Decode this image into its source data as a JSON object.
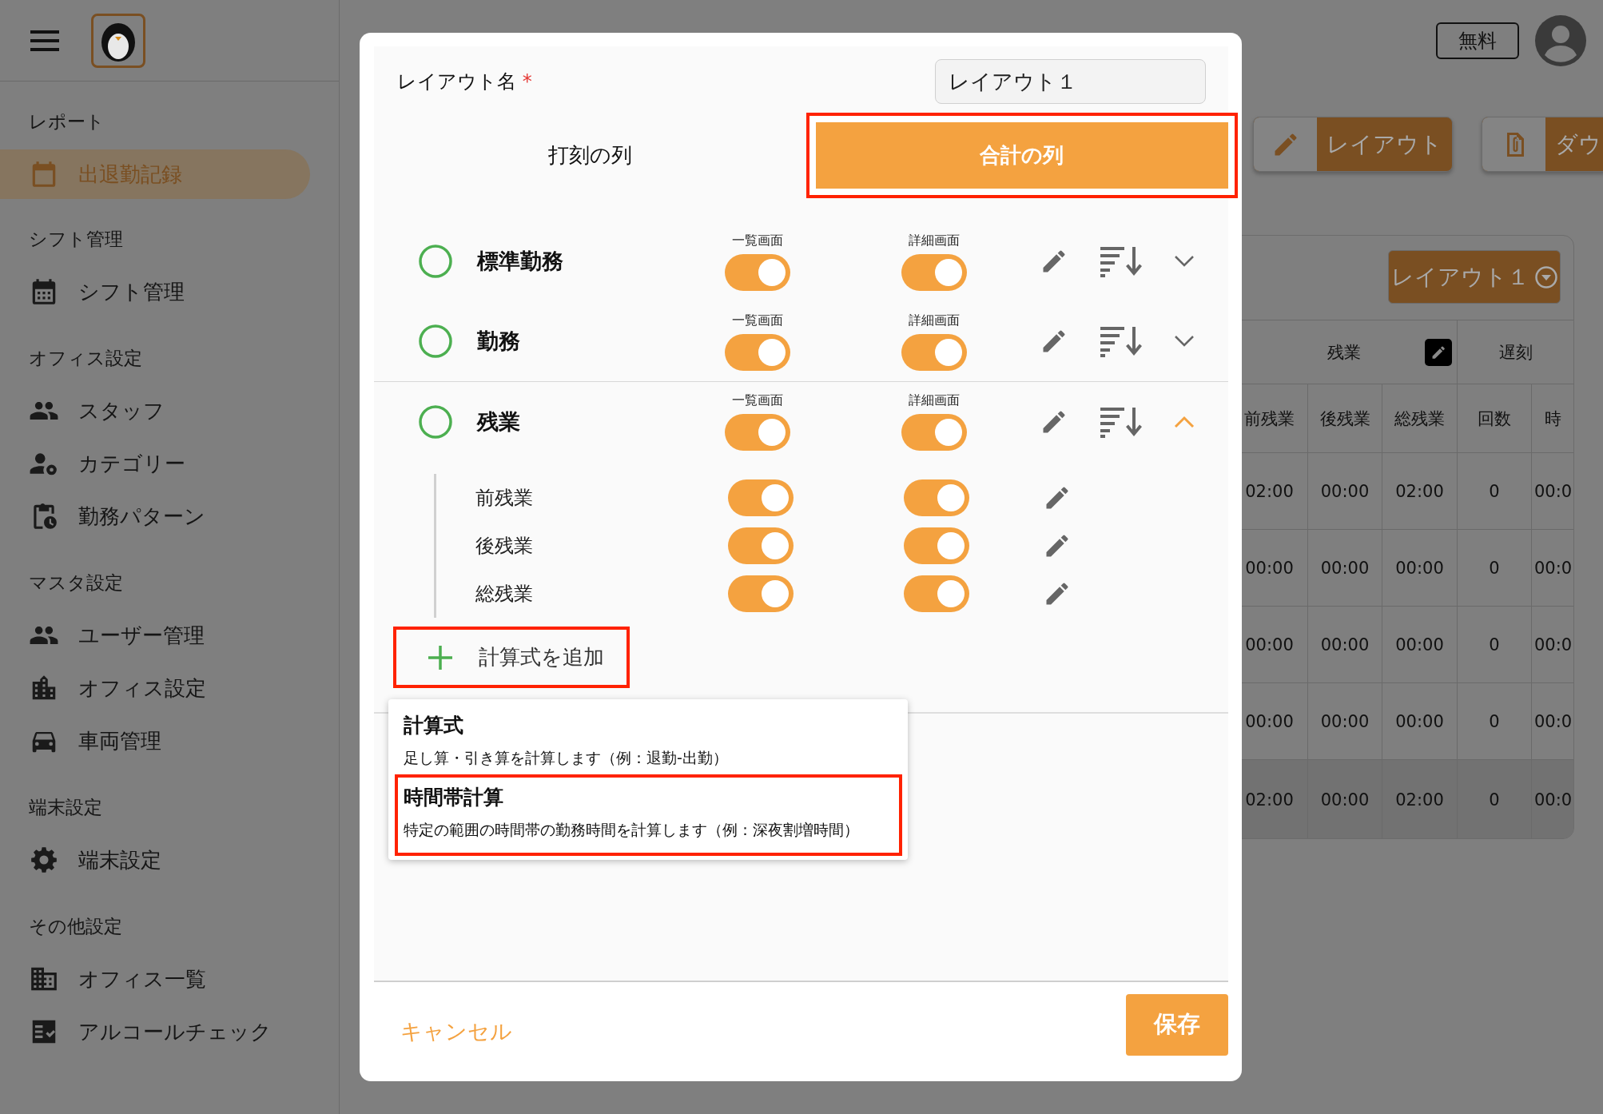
{
  "sidebar": {
    "sections": [
      {
        "title": "レポート",
        "items": [
          {
            "label": "出退勤記録",
            "selected": true
          }
        ]
      },
      {
        "title": "シフト管理",
        "items": [
          {
            "label": "シフト管理",
            "selected": false
          }
        ]
      },
      {
        "title": "オフィス設定",
        "items": [
          {
            "label": "スタッフ",
            "selected": false
          },
          {
            "label": "カテゴリー",
            "selected": false
          },
          {
            "label": "勤務パターン",
            "selected": false
          }
        ]
      },
      {
        "title": "マスタ設定",
        "items": [
          {
            "label": "ユーザー管理",
            "selected": false
          },
          {
            "label": "オフィス設定",
            "selected": false
          },
          {
            "label": "車両管理",
            "selected": false
          }
        ]
      },
      {
        "title": "端末設定",
        "items": [
          {
            "label": "端末設定",
            "selected": false
          }
        ]
      },
      {
        "title": "その他設定",
        "items": [
          {
            "label": "オフィス一覧",
            "selected": false
          },
          {
            "label": "アルコールチェック",
            "selected": false
          }
        ]
      }
    ]
  },
  "header": {
    "plan_badge": "無料"
  },
  "toolbar": {
    "buttons": [
      {
        "label": "レイアウト"
      },
      {
        "label": "ダウ"
      }
    ]
  },
  "table": {
    "layout_select": "レイアウト１",
    "groups": [
      {
        "label": "残業",
        "editable": true,
        "columns": [
          "前残業",
          "後残業",
          "総残業"
        ]
      },
      {
        "label": "遅刻",
        "editable": false,
        "columns": [
          "回数",
          "時"
        ]
      }
    ],
    "rows": [
      {
        "kind": "data",
        "cells": [
          "02:00",
          "00:00",
          "02:00",
          "0",
          "00:0"
        ]
      },
      {
        "kind": "data",
        "cells": [
          "00:00",
          "00:00",
          "00:00",
          "0",
          "00:0"
        ]
      },
      {
        "kind": "data",
        "cells": [
          "00:00",
          "00:00",
          "00:00",
          "0",
          "00:0"
        ]
      },
      {
        "kind": "data",
        "cells": [
          "00:00",
          "00:00",
          "00:00",
          "0",
          "00:0"
        ]
      },
      {
        "kind": "total",
        "cells": [
          "02:00",
          "00:00",
          "02:00",
          "0",
          "00:0"
        ]
      }
    ]
  },
  "dialog": {
    "name_label": "レイアウト名",
    "required_mark": "*",
    "name_value": "レイアウト１",
    "tabs": [
      {
        "label": "打刻の列",
        "selected": false,
        "highlighted": false
      },
      {
        "label": "合計の列",
        "selected": true,
        "highlighted": true
      }
    ],
    "columns": [
      {
        "name": "標準勤務",
        "list_label": "一覧画面",
        "detail_label": "詳細画面",
        "list_on": true,
        "detail_on": true,
        "expanded": false
      },
      {
        "name": "勤務",
        "list_label": "一覧画面",
        "detail_label": "詳細画面",
        "list_on": true,
        "detail_on": true,
        "expanded": false
      },
      {
        "name": "残業",
        "list_label": "一覧画面",
        "detail_label": "詳細画面",
        "list_on": true,
        "detail_on": true,
        "expanded": true,
        "children": [
          {
            "name": "前残業",
            "list_on": true,
            "detail_on": true
          },
          {
            "name": "後残業",
            "list_on": true,
            "detail_on": true
          },
          {
            "name": "総残業",
            "list_on": true,
            "detail_on": true
          }
        ]
      }
    ],
    "add_button": {
      "label": "計算式を追加",
      "highlighted": true
    },
    "add_menu": [
      {
        "title": "計算式",
        "description": "足し算・引き算を計算します（例：退勤-出勤）",
        "highlighted": false
      },
      {
        "title": "時間帯計算",
        "description": "特定の範囲の時間帯の勤務時間を計算します（例：深夜割増時間）",
        "highlighted": true
      }
    ],
    "cancel": "キャンセル",
    "save": "保存"
  }
}
